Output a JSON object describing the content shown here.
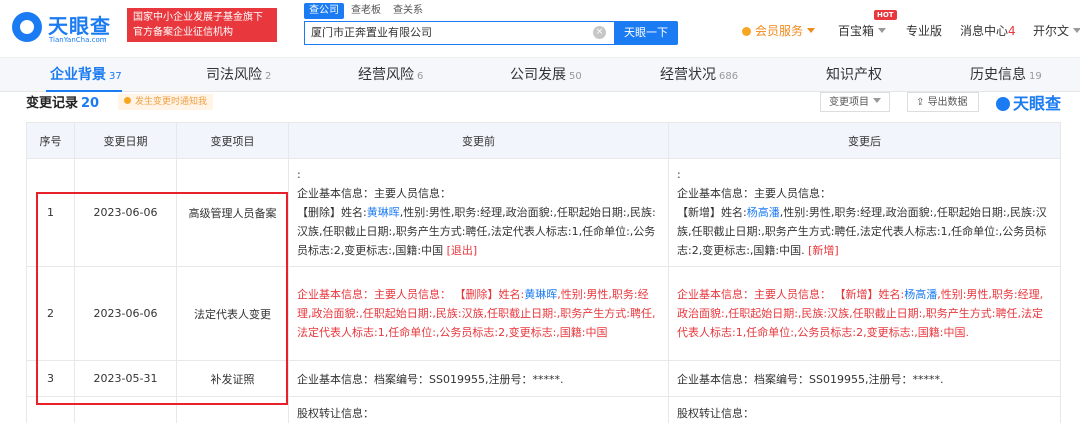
{
  "header": {
    "logo_text": "天眼查",
    "logo_sub": "TianYanCha.com",
    "badge_line1": "国家中小企业发展子基金旗下",
    "badge_line2": "官方备案企业征信机构",
    "search_tabs": [
      "查公司",
      "查老板",
      "查关系"
    ],
    "search_value": "厦门市正奔置业有限公司",
    "search_button": "天眼一下",
    "vip": "会员服务",
    "treasure": "百宝箱",
    "hot": "HOT",
    "pro": "专业版",
    "msg_label": "消息中心",
    "msg_count": "4",
    "user": "开尔文"
  },
  "section_tabs": [
    {
      "label": "企业背景",
      "count": "37"
    },
    {
      "label": "司法风险",
      "count": "2"
    },
    {
      "label": "经营风险",
      "count": "6"
    },
    {
      "label": "公司发展",
      "count": "50"
    },
    {
      "label": "经营状况",
      "count": "686"
    },
    {
      "label": "知识产权",
      "count": ""
    },
    {
      "label": "历史信息",
      "count": "19"
    }
  ],
  "records": {
    "title": "变更记录",
    "count": "20",
    "tip": "发生变更时通知我",
    "filter_button": "变更项目",
    "export_button": "导出数据",
    "watermark": "天眼查"
  },
  "table": {
    "headers": [
      "序号",
      "变更日期",
      "变更项目",
      "变更前",
      "变更后"
    ],
    "rows": [
      {
        "seq": "1",
        "date": "2023-06-06",
        "item": "高级管理人员备案",
        "before_lead": ":",
        "before_title": "企业基本信息：主要人员信息：",
        "before_tag": "【删除】姓名:",
        "before_name": "黄琳晖",
        "before_body": ",性别:男性,职务:经理,政治面貌:,任职起始日期:,民族:汉族,任职截止日期:,职务产生方式:聘任,法定代表人标志:1,任命单位:,公务员标志:2,变更标志:,国籍:中国",
        "before_suffix": "[退出]",
        "after_lead": ":",
        "after_title": "企业基本信息：主要人员信息：",
        "after_tag": "【新增】姓名:",
        "after_name": "杨高潘",
        "after_body": ",性别:男性,职务:经理,政治面貌:,任职起始日期:,民族:汉族,任职截止日期:,职务产生方式:聘任,法定代表人标志:1,任命单位:,公务员标志:2,变更标志:,国籍:中国.",
        "after_suffix": "[新增]"
      },
      {
        "seq": "2",
        "date": "2023-06-06",
        "item": "法定代表人变更",
        "before_prefix": "企业基本信息：主要人员信息：  【删除】姓名:",
        "before_name": "黄琳晖",
        "before_body": ",性别:男性,职务:经理,政治面貌:,任职起始日期:,民族:汉族,任职截止日期:,职务产生方式:聘任,法定代表人标志:1,任命单位:,公务员标志:2,变更标志:,国籍:中国",
        "after_prefix": "企业基本信息：主要人员信息：  【新增】姓名:",
        "after_name": "杨高潘",
        "after_body": ",性别:男性,职务:经理,政治面貌:,任职起始日期:,民族:汉族,任职截止日期:,职务产生方式:聘任,法定代表人标志:1,任命单位:,公务员标志:2,变更标志:,国籍:中国."
      },
      {
        "seq": "3",
        "date": "2023-05-31",
        "item": "补发证照",
        "before": "企业基本信息：档案编号：SS019955,注册号：*****.",
        "after": "企业基本信息：档案编号：SS019955,注册号：*****."
      },
      {
        "seq": "",
        "date": "",
        "item": "",
        "before": "股权转让信息：",
        "after": "股权转让信息："
      }
    ]
  },
  "colors": {
    "brand": "#1b7bf2",
    "red": "#e8373d",
    "orange": "#f08a1c"
  }
}
